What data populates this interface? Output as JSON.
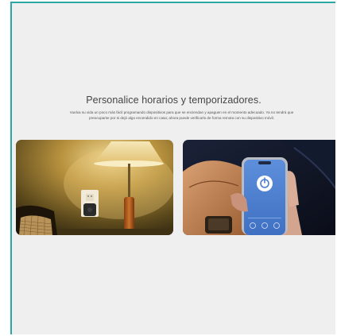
{
  "section": {
    "headline": "Personalice horarios y temporizadores.",
    "description": "Vuelva su vida un poco más fácil programando dispositivos para que se enciendan y apaguen en el momento adecuado. Ya no tendrá que preocuparse por si dejó algo encendido en casa; ahora puede verificarlo de forma remota con su dispositivo móvil."
  },
  "colors": {
    "accent_border": "#2aa8a4",
    "page_background": "#efefef",
    "app_screen_blue": "#4a7fd0"
  },
  "images": [
    {
      "name": "lamp-and-smart-plug-photo"
    },
    {
      "name": "phone-app-control-photo"
    }
  ]
}
